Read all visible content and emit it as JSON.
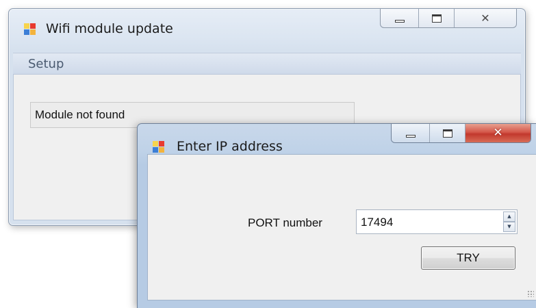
{
  "main_window": {
    "title": "Wifi module update",
    "caption_buttons": {
      "minimize_icon": "minimize-icon",
      "maximize_icon": "maximize-icon",
      "close_icon": "close-icon"
    },
    "menu": {
      "items": [
        {
          "label": "Setup"
        }
      ]
    },
    "status_text": "Module not found"
  },
  "dialog": {
    "title": "Enter IP address",
    "port_label": "PORT number",
    "port_value": "17494",
    "try_button": "TRY",
    "close_button_color": "#c8402f"
  }
}
